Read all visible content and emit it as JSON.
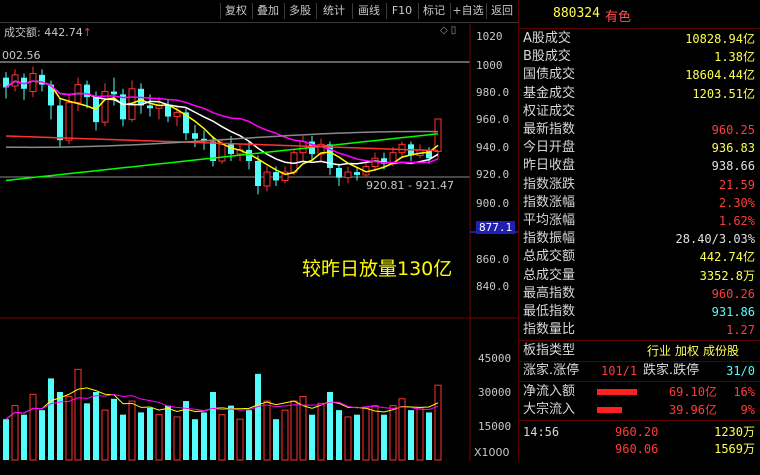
{
  "toolbar": {
    "items": [
      "复权",
      "叠加",
      "多股",
      "统计",
      "画线",
      "F10",
      "标记",
      "+自选",
      "返回"
    ]
  },
  "chart": {
    "amount_label": "成交额: 442.74",
    "amount_arrow": "↑",
    "price_level": "002.56",
    "range_label": "920.81 - 921.47",
    "annotation": "较昨日放量130亿",
    "price_axis": [
      "1020",
      "1000",
      "980.0",
      "960.0",
      "940.0",
      "920.0",
      "900.0",
      "877.1",
      "860.0",
      "840.0"
    ],
    "volume_axis": [
      "45000",
      "30000",
      "15000"
    ],
    "volume_unit": "X1000",
    "colors": {
      "up": "#ff3232",
      "down": "#54fcfc",
      "ma5": "#ffffff",
      "ma10": "#ffff00",
      "ma20": "#ff00ff",
      "ma60": "#00ff00",
      "ma120": "#ff3232"
    }
  },
  "panel": {
    "code": "880324",
    "name": "有色",
    "stats": [
      {
        "label": "A股成交",
        "value": "10828.94亿",
        "color": "#ffff50"
      },
      {
        "label": "B股成交",
        "value": "1.38亿",
        "color": "#ffff50"
      },
      {
        "label": "国债成交",
        "value": "18604.44亿",
        "color": "#ffff50"
      },
      {
        "label": "基金成交",
        "value": "1203.51亿",
        "color": "#ffff50"
      },
      {
        "label": "权证成交",
        "value": "",
        "color": "#ffff50"
      },
      {
        "label": "最新指数",
        "value": "960.25",
        "color": "#ff3c3c"
      },
      {
        "label": "今日开盘",
        "value": "936.83",
        "color": "#ffff50"
      },
      {
        "label": "昨日收盘",
        "value": "938.66",
        "color": "#e0e0e0"
      },
      {
        "label": "指数涨跌",
        "value": "21.59",
        "color": "#ff3c3c"
      },
      {
        "label": "指数涨幅",
        "value": "2.30%",
        "color": "#ff3c3c"
      },
      {
        "label": "平均涨幅",
        "value": "1.62%",
        "color": "#ff3c3c"
      },
      {
        "label": "指数振幅",
        "value": "28.40/3.03%",
        "color": "#e0e0e0"
      },
      {
        "label": "总成交额",
        "value": "442.74亿",
        "color": "#ffff50"
      },
      {
        "label": "总成交量",
        "value": "3352.8万",
        "color": "#ffff50"
      },
      {
        "label": "最高指数",
        "value": "960.26",
        "color": "#ff3c3c"
      },
      {
        "label": "最低指数",
        "value": "931.86",
        "color": "#54fcfc"
      },
      {
        "label": "指数量比",
        "value": "1.27",
        "color": "#ff3c3c"
      }
    ],
    "board_label": "板指类型",
    "board_values": [
      "行业",
      "加权",
      "成份股"
    ],
    "updown": {
      "up_label": "涨家.涨停",
      "up_value": "101/1",
      "down_label": "跌家.跌停",
      "down_value": "31/0"
    },
    "flows": [
      {
        "label": "净流入额",
        "value": "69.10亿",
        "pct": "16%",
        "bar": 0.72
      },
      {
        "label": "大宗流入",
        "value": "39.96亿",
        "pct": "9%",
        "bar": 0.44
      }
    ],
    "ticks": [
      {
        "time": "14:56",
        "price": "960.20",
        "vol": "1230万"
      },
      {
        "time": "",
        "price": "960.06",
        "vol": "1569万"
      },
      {
        "time": "",
        "price": "",
        "vol": ""
      }
    ]
  }
}
